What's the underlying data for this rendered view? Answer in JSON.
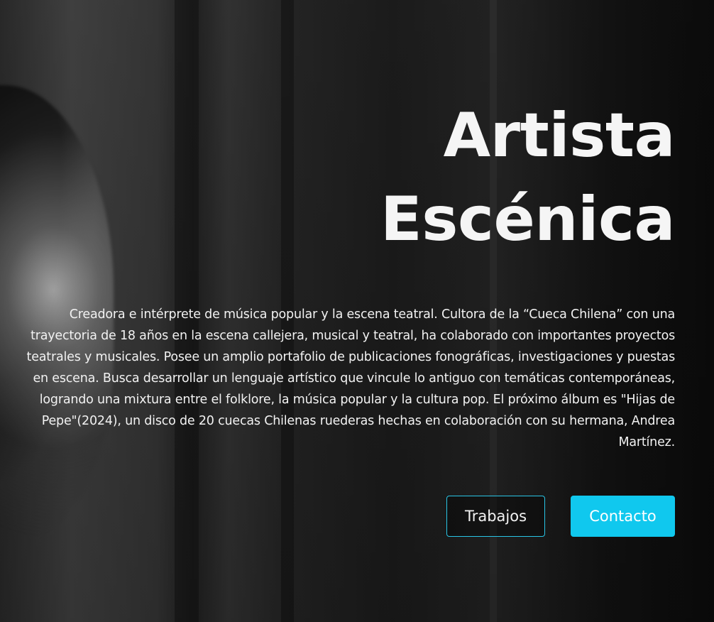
{
  "hero": {
    "title_line1": "Artista",
    "title_line2": "Escénica",
    "description": "Creadora e intérprete de música popular y la escena teatral. Cultora de la “Cueca Chilena” con una trayectoria de 18 años en la escena callejera, musical y teatral, ha colaborado con importantes proyectos teatrales y musicales. Posee un amplio portafolio de publicaciones fonográficas, investigaciones y puestas en escena. Busca desarrollar un lenguaje artístico que vincule lo antiguo con temáticas contemporáneas, logrando una mixtura entre el folklore, la música popular y la cultura pop. El próximo álbum es \"Hijas de Pepe\"(2024), un disco de 20 cuecas Chilenas ruederas hechas en colaboración con su hermana, Andrea Martínez.",
    "buttons": {
      "works_label": "Trabajos",
      "contact_label": "Contacto"
    }
  },
  "colors": {
    "accent": "#10c8ee",
    "outline_border": "#29c5e6",
    "text": "#f5f5f5"
  }
}
